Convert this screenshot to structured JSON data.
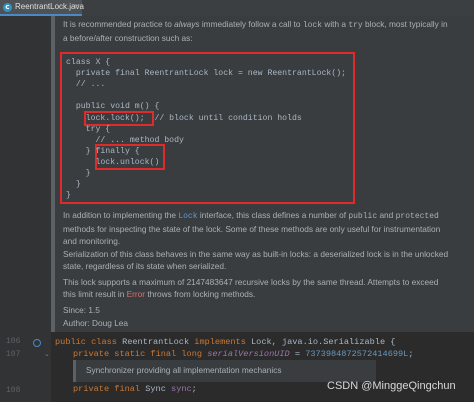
{
  "tab": {
    "icon": "c",
    "label": "ReentrantLock.java",
    "close": "×"
  },
  "intro": {
    "t1": "It is recommended practice to ",
    "t2": "always",
    "t3": " immediately follow a call to ",
    "t4": "lock",
    "t5": " with a ",
    "t6": "try",
    "t7": " block, most typically in",
    "t8": "a before/after construction such as:"
  },
  "code_lines": [
    "class X {",
    "  private final ReentrantLock lock = new ReentrantLock();",
    "  // ...",
    "",
    "  public void m() {",
    "    lock.lock();  // block until condition holds",
    "    try {",
    "      // ... method body",
    "    } finally {",
    "      lock.unlock()",
    "    }",
    "  }",
    "}"
  ],
  "para1": {
    "t1": "In addition to implementing the ",
    "t2": "Lock",
    "t3": " interface, this class defines a number of ",
    "t4": "public",
    "t5": " and ",
    "t6": "protected",
    "t7": "methods for inspecting the state of the lock. Some of these methods are only useful for instrumentation",
    "t8": "and monitoring."
  },
  "para2": {
    "l1": "Serialization of this class behaves in the same way as built-in locks: a deserialized lock is in the unlocked",
    "l2": "state, regardless of its state when serialized."
  },
  "para3": {
    "l1": "This lock supports a maximum of 2147483647 recursive locks by the same thread. Attempts to exceed",
    "t1": "this limit result in ",
    "t2": "Error",
    "t3": " throws from locking methods."
  },
  "since": "Since:   1.5",
  "author": "Author: Doug Lea",
  "line_numbers": [
    "106",
    "107",
    "108"
  ],
  "source": {
    "kw_public": "public",
    "kw_class": "class",
    "class_name": " ReentrantLock ",
    "kw_implements": "implements",
    "interfaces": " Lock, java.io.Serializable {",
    "kw_private": "private",
    "kw_static": "static",
    "kw_final": "final",
    "kw_long": "long",
    "field_svuid": "serialVersionUID",
    "assign": " = ",
    "svuid_value": "7373984872572414699L",
    "semicolon": ";",
    "sync_doc": "Synchronizer providing all implementation mechanics",
    "sync_type": " Sync ",
    "sync_field": "sync",
    "sync_end": ";"
  },
  "watermark": "CSDN @MinggeQingchun"
}
